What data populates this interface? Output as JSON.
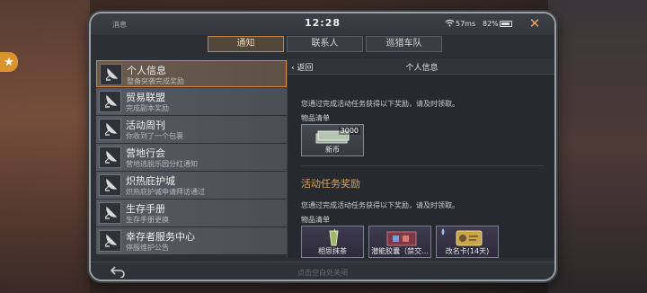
{
  "device": {
    "app_name": "消息",
    "clock": "12:28",
    "network_ping": "57ms",
    "battery_percent": "82%"
  },
  "tabs": [
    {
      "label": "通知",
      "active": true
    },
    {
      "label": "联系人",
      "active": false
    },
    {
      "label": "巡猎车队",
      "active": false
    }
  ],
  "messages": [
    {
      "title": "个人信息",
      "subtitle": "整备突袭完成奖励",
      "selected": true
    },
    {
      "title": "贸易联盟",
      "subtitle": "完成副本奖励",
      "selected": false
    },
    {
      "title": "活动周刊",
      "subtitle": "你收到了一个包裹",
      "selected": false
    },
    {
      "title": "营地行会",
      "subtitle": "营地逃脱乐园分红通知",
      "selected": false
    },
    {
      "title": "炽热庇护城",
      "subtitle": "炽热庇护城申请拜访通过",
      "selected": false
    },
    {
      "title": "生存手册",
      "subtitle": "生存手册更换",
      "selected": false
    },
    {
      "title": "幸存者服务中心",
      "subtitle": "停服维护公告",
      "selected": false
    }
  ],
  "detail": {
    "back_label": "返回",
    "title": "个人信息",
    "notice_1": "您通过完成活动任务获得以下奖励，请及时领取。",
    "items_label_1": "物品清单",
    "items_1": [
      {
        "name": "新币",
        "quantity": "3000"
      }
    ],
    "section_title": "活动任务奖励",
    "notice_2": "您通过完成活动任务获得以下奖励，请及时领取。",
    "items_label_2": "物品清单",
    "items_2": [
      {
        "name": "相思抹茶"
      },
      {
        "name": "潜能胶囊（禁交..."
      },
      {
        "name": "改名卡(14天)"
      }
    ]
  },
  "footer": {
    "hint": "点击空白处关闭"
  },
  "colors": {
    "accent_orange": "#d88a3a",
    "reward_title": "#e0a35a",
    "close_icon": "#e8a061"
  }
}
